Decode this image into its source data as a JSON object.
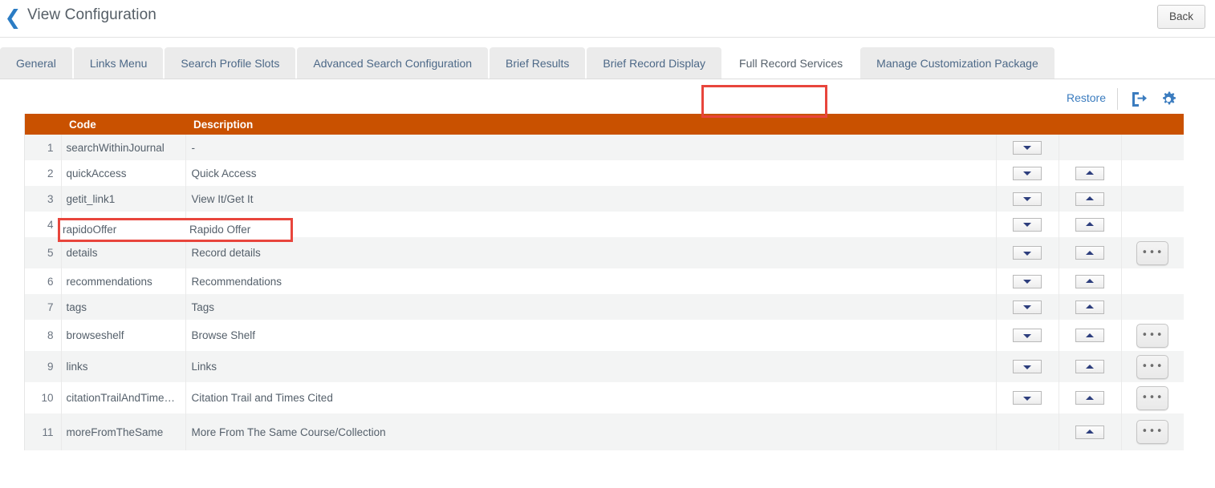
{
  "header": {
    "back_chevron_icon": "chevron-left-icon",
    "title": "View Configuration",
    "back_label": "Back"
  },
  "tabs": [
    {
      "label": "General",
      "active": false
    },
    {
      "label": "Links Menu",
      "active": false
    },
    {
      "label": "Search Profile Slots",
      "active": false
    },
    {
      "label": "Advanced Search Configuration",
      "active": false
    },
    {
      "label": "Brief Results",
      "active": false
    },
    {
      "label": "Brief Record Display",
      "active": false
    },
    {
      "label": "Full Record Services",
      "active": true
    },
    {
      "label": "Manage Customization Package",
      "active": false
    }
  ],
  "toolbar": {
    "restore_label": "Restore",
    "export_icon": "export-icon",
    "settings_icon": "gear-icon"
  },
  "table": {
    "columns": [
      "",
      "Code",
      "Description",
      "",
      "",
      ""
    ],
    "header_color": "#c95100",
    "rows": [
      {
        "num": "1",
        "code": "searchWithinJournal",
        "desc": "-",
        "down": true,
        "up": false,
        "more": false
      },
      {
        "num": "2",
        "code": "quickAccess",
        "desc": "Quick Access",
        "down": true,
        "up": true,
        "more": false
      },
      {
        "num": "3",
        "code": "getit_link1",
        "desc": "View It/Get It",
        "down": true,
        "up": true,
        "more": false
      },
      {
        "num": "4",
        "code": "rapidoOffer",
        "desc": "Rapido Offer",
        "down": true,
        "up": true,
        "more": false
      },
      {
        "num": "5",
        "code": "details",
        "desc": "Record details",
        "down": true,
        "up": true,
        "more": true
      },
      {
        "num": "6",
        "code": "recommendations",
        "desc": "Recommendations",
        "down": true,
        "up": true,
        "more": false
      },
      {
        "num": "7",
        "code": "tags",
        "desc": "Tags",
        "down": true,
        "up": true,
        "more": false
      },
      {
        "num": "8",
        "code": "browseshelf",
        "desc": "Browse Shelf",
        "down": true,
        "up": true,
        "more": true
      },
      {
        "num": "9",
        "code": "links",
        "desc": "Links",
        "down": true,
        "up": true,
        "more": true
      },
      {
        "num": "10",
        "code": "citationTrailAndTime…",
        "desc": "Citation Trail and Times Cited",
        "down": true,
        "up": true,
        "more": true
      },
      {
        "num": "11",
        "code": "moreFromTheSame",
        "desc": "More From The Same Course/Collection",
        "down": false,
        "up": true,
        "more": true
      }
    ]
  },
  "annotations": {
    "highlight_color": "#e8453c",
    "tab_highlight_target": "Full Record Services",
    "row_highlight_code": "rapidoOffer",
    "row_highlight_desc": "Rapido Offer"
  },
  "more_button_label": "•••"
}
